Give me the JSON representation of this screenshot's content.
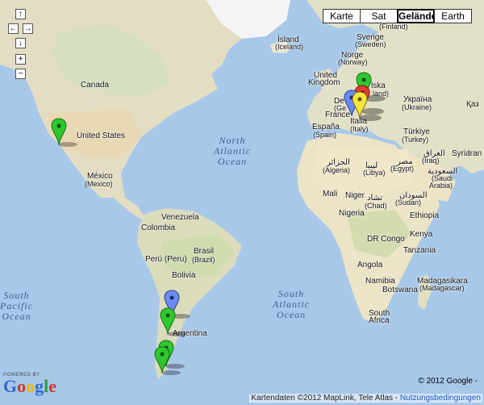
{
  "controls": {
    "pan_up": "↑",
    "pan_left": "←",
    "pan_right": "→",
    "pan_down": "↓",
    "zoom_in": "+",
    "zoom_out": "−"
  },
  "map_types": {
    "karte": "Karte",
    "sat": "Sat",
    "gelaende": "Gelände",
    "earth": "Earth",
    "active": "Gelände"
  },
  "oceans": {
    "north_atlantic": "North\nAtlantic\nOcean",
    "south_pacific": "South\nPacific\nOcean",
    "south_atlantic": "South\nAtlantic\nOcean"
  },
  "labels": {
    "canada": "Canada",
    "united_states": "United States",
    "mexico": "México",
    "mexico_sub": "(Mexico)",
    "venezuela": "Venezuela",
    "colombia": "Colombia",
    "brasil": "Brasil",
    "brasil_sub": "(Brazil)",
    "peru": "Perú (Peru)",
    "bolivia": "Bolivia",
    "argentina": "Argentina",
    "island": "Ísland",
    "island_sub": "(Iceland)",
    "sverige": "Sverige",
    "sverige_sub": "(Sweden)",
    "finland_sub": "(Finland)",
    "norge": "Norge",
    "norge_sub": "(Norway)",
    "uk": "United",
    "uk2": "Kingdom",
    "polska": "lska",
    "poland_sub": "land)",
    "ukraina": "Україна",
    "ukraine_sub": "(Ukraine)",
    "deutschland": "De",
    "germany_sub": "(Ge",
    "france": "France",
    "italia": "Italia",
    "italy_sub": "(Italy)",
    "espana": "España",
    "spain_sub": "(Spain)",
    "turkiye": "Türkiye",
    "turkey_sub": "(Turkey)",
    "algeria_ar": "الجزائر",
    "algeria_sub": "(Algeria)",
    "libya_ar": "ليبيا",
    "libya_sub": "(Libya)",
    "egypt_ar": "مصر",
    "egypt_sub": "(Egypt)",
    "iraq_ar": "العراق",
    "iraq_sub": "(Iraq)",
    "saudi_ar": "السعودية",
    "saudi_sub": "(Saudi",
    "saudi_sub2": "Arabia)",
    "mali": "Mali",
    "niger": "Niger",
    "chad_ar": "تشاد",
    "chad_sub": "(Chad)",
    "sudan_ar": "السودان",
    "sudan_sub": "(Sudan)",
    "nigeria": "Nigeria",
    "ethiopia": "Ethiopia",
    "dr_congo": "DR Congo",
    "kenya": "Kenya",
    "tanzania": "Tanzania",
    "angola": "Angola",
    "namibia": "Namibia",
    "botswana": "Botswana",
    "madagascar": "Madagasikara",
    "madagascar_sub": "(Madagascar)",
    "south_africa": "South",
    "south_africa2": "Africa",
    "syria": "Syria",
    "iran": "Iran",
    "kazakh": "Қаз"
  },
  "branding": {
    "powered_by": "POWERED BY",
    "google": "Google",
    "copyright": "© 2012 Google -",
    "map_data": "Kartendaten ©2012 MapLink, Tele Atlas -",
    "terms": "Nutzungsbedingungen"
  },
  "colors": {
    "water": "#a8c8ea",
    "land": "#e4e0cc",
    "pin_green": "#2ec82e",
    "pin_blue": "#6a8cf2",
    "pin_yellow": "#f2e640",
    "pin_red": "#e04030"
  },
  "markers": [
    {
      "color": "green",
      "location": "western-united-states"
    },
    {
      "color": "blue",
      "location": "bolivia-chile"
    },
    {
      "color": "green",
      "location": "chile-central"
    },
    {
      "color": "green",
      "location": "patagonia"
    },
    {
      "color": "green",
      "location": "patagonia-south"
    },
    {
      "color": "green",
      "location": "poland"
    },
    {
      "color": "blue",
      "location": "france"
    },
    {
      "color": "yellow",
      "location": "italy"
    },
    {
      "color": "red",
      "location": "germany"
    }
  ]
}
